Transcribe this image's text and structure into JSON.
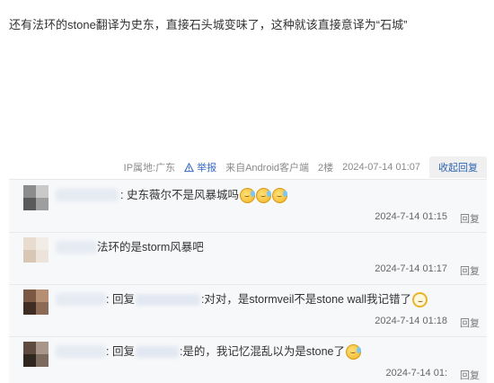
{
  "post": {
    "text": "还有法环的stone翻译为史东，直接石头城变味了，这种就该直接意译为“石城”"
  },
  "meta": {
    "ip": "IP属地:广东",
    "report": "举报",
    "source": "来自Android客户端",
    "floor": "2楼",
    "time": "2024-07-14 01:07",
    "collapse": "收起回复"
  },
  "replies": [
    {
      "text": ": 史东薇尔不是风暴城吗",
      "emojis": [
        "tear-emoji",
        "tear-emoji",
        "tear-emoji"
      ],
      "time": "2024-7-14 01:15",
      "reply_label": "回复"
    },
    {
      "text": "法环的是storm风暴吧",
      "time": "2024-7-14 01:17",
      "reply_label": "回复"
    },
    {
      "prefix": ": 回复",
      "text": ":对对，是stormveil不是stone wall我记错了",
      "emojis": [
        "ring-emoji"
      ],
      "time": "2024-7-14 01:18",
      "reply_label": "回复"
    },
    {
      "prefix": ": 回复",
      "text": ":是的，我记忆混乱以为是stone了",
      "emojis": [
        "laugh-emoji"
      ],
      "time": "2024-7-14 01:",
      "reply_label": "回复"
    }
  ],
  "colors": {
    "link": "#3a6bc5",
    "panel_bg": "#f7f8fa"
  }
}
